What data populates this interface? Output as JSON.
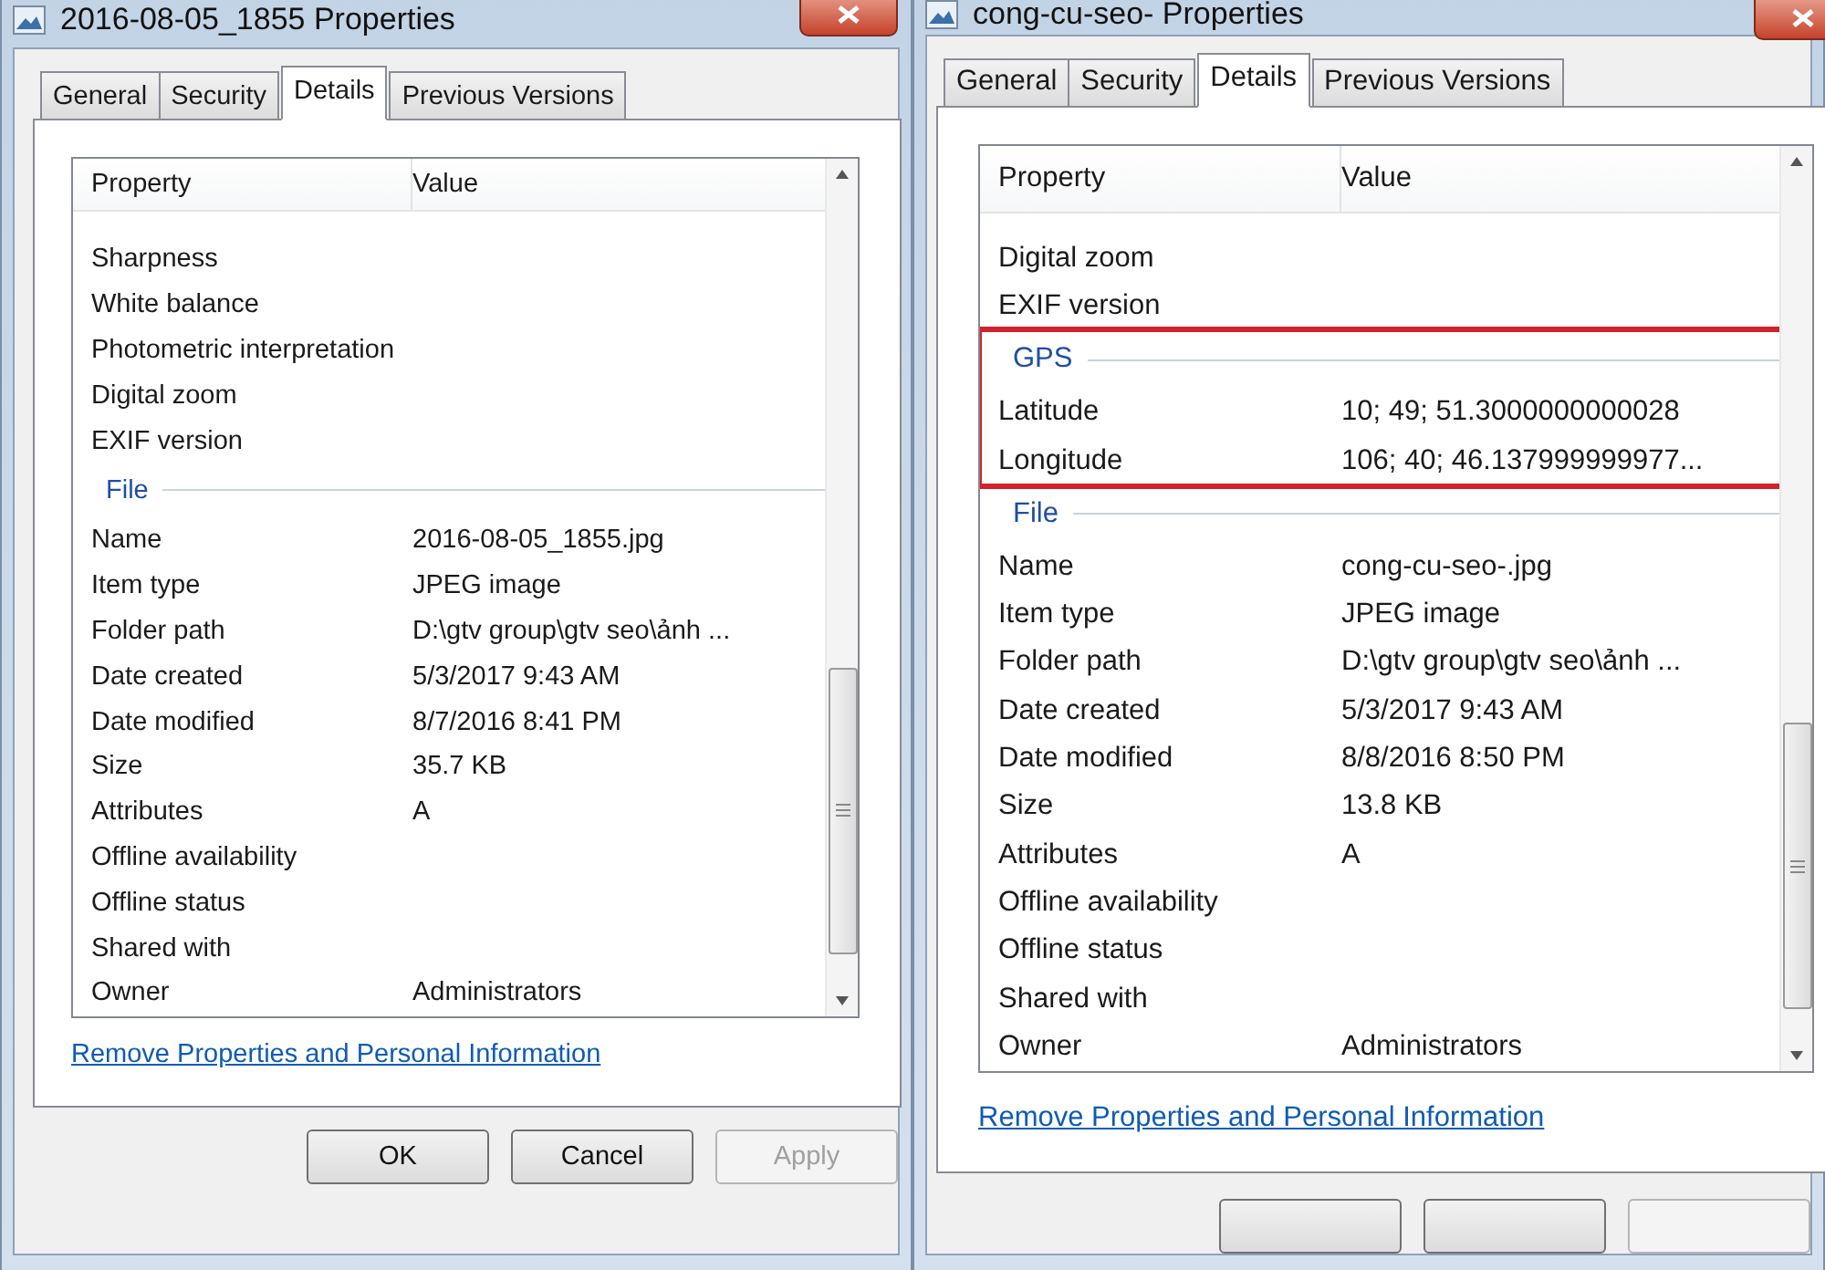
{
  "dialogs": [
    {
      "title": "2016-08-05_1855 Properties",
      "tabs": [
        {
          "label": "General",
          "selected": false
        },
        {
          "label": "Security",
          "selected": false
        },
        {
          "label": "Details",
          "selected": true
        },
        {
          "label": "Previous Versions",
          "selected": false
        }
      ],
      "columns": [
        "Property",
        "Value"
      ],
      "sections": [
        {
          "rows": [
            {
              "property": "Sharpness",
              "value": ""
            },
            {
              "property": "White balance",
              "value": ""
            },
            {
              "property": "Photometric interpretation",
              "value": ""
            },
            {
              "property": "Digital zoom",
              "value": ""
            },
            {
              "property": "EXIF version",
              "value": ""
            }
          ]
        },
        {
          "label": "File",
          "rows": [
            {
              "property": "Name",
              "value": "2016-08-05_1855.jpg"
            },
            {
              "property": "Item type",
              "value": "JPEG image"
            },
            {
              "property": "Folder path",
              "value": "D:\\gtv group\\gtv seo\\ảnh ..."
            },
            {
              "property": "Date created",
              "value": "5/3/2017 9:43 AM"
            },
            {
              "property": "Date modified",
              "value": "8/7/2016 8:41 PM"
            },
            {
              "property": "Size",
              "value": "35.7 KB"
            },
            {
              "property": "Attributes",
              "value": "A"
            },
            {
              "property": "Offline availability",
              "value": ""
            },
            {
              "property": "Offline status",
              "value": ""
            },
            {
              "property": "Shared with",
              "value": ""
            },
            {
              "property": "Owner",
              "value": "Administrators"
            }
          ]
        }
      ],
      "link": "Remove Properties and Personal Information",
      "buttons": [
        {
          "label": "OK",
          "disabled": false
        },
        {
          "label": "Cancel",
          "disabled": false
        },
        {
          "label": "Apply",
          "disabled": true
        }
      ]
    },
    {
      "title": "cong-cu-seo- Properties",
      "tabs": [
        {
          "label": "General",
          "selected": false
        },
        {
          "label": "Security",
          "selected": false
        },
        {
          "label": "Details",
          "selected": true
        },
        {
          "label": "Previous Versions",
          "selected": false
        }
      ],
      "columns": [
        "Property",
        "Value"
      ],
      "sections": [
        {
          "rows": [
            {
              "property": "Digital zoom",
              "value": ""
            },
            {
              "property": "EXIF version",
              "value": ""
            }
          ]
        },
        {
          "label": "GPS",
          "highlighted": true,
          "rows": [
            {
              "property": "Latitude",
              "value": "10; 49; 51.3000000000028"
            },
            {
              "property": "Longitude",
              "value": "106; 40; 46.137999999977..."
            }
          ]
        },
        {
          "label": "File",
          "rows": [
            {
              "property": "Name",
              "value": "cong-cu-seo-.jpg"
            },
            {
              "property": "Item type",
              "value": "JPEG image"
            },
            {
              "property": "Folder path",
              "value": "D:\\gtv group\\gtv seo\\ảnh ..."
            },
            {
              "property": "Date created",
              "value": "5/3/2017 9:43 AM"
            },
            {
              "property": "Date modified",
              "value": "8/8/2016 8:50 PM"
            },
            {
              "property": "Size",
              "value": "13.8 KB"
            },
            {
              "property": "Attributes",
              "value": "A"
            },
            {
              "property": "Offline availability",
              "value": ""
            },
            {
              "property": "Offline status",
              "value": ""
            },
            {
              "property": "Shared with",
              "value": ""
            },
            {
              "property": "Owner",
              "value": "Administrators"
            }
          ]
        }
      ],
      "link": "Remove Properties and Personal Information",
      "buttons": [
        {
          "disabled": false
        },
        {
          "disabled": false
        },
        {
          "disabled": true
        }
      ]
    }
  ]
}
